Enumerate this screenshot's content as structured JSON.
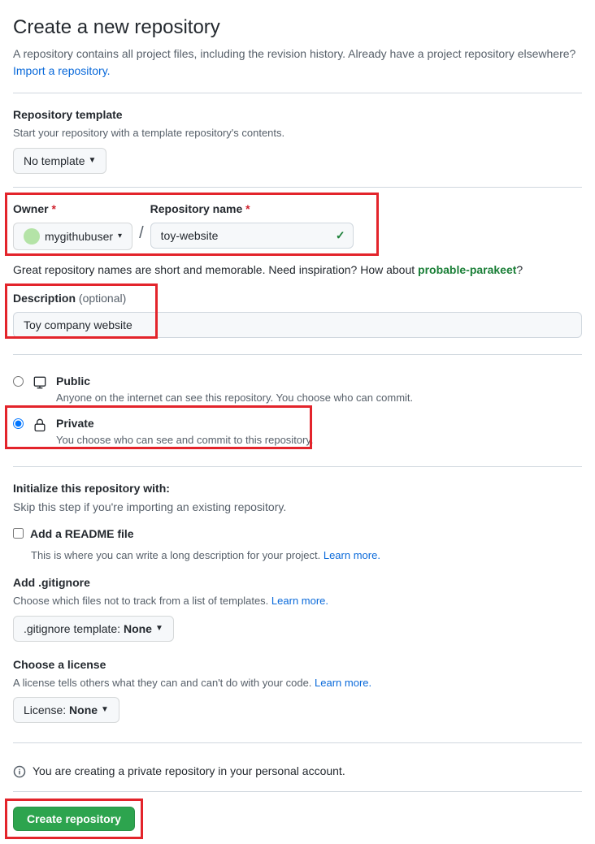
{
  "header": {
    "title": "Create a new repository",
    "subhead": "A repository contains all project files, including the revision history. Already have a project repository elsewhere? ",
    "import_link": "Import a repository."
  },
  "template": {
    "label": "Repository template",
    "help": "Start your repository with a template repository's contents.",
    "button": "No template"
  },
  "owner": {
    "label": "Owner",
    "username": "mygithubuser"
  },
  "repo_name": {
    "label": "Repository name",
    "value": "toy-website"
  },
  "name_hint": {
    "prefix": "Great repository names are short and memorable. Need inspiration? How about ",
    "suggestion": "probable-parakeet",
    "suffix": "?"
  },
  "description": {
    "label": "Description",
    "optional": "(optional)",
    "value": "Toy company website"
  },
  "visibility": {
    "public": {
      "title": "Public",
      "desc": "Anyone on the internet can see this repository. You choose who can commit."
    },
    "private": {
      "title": "Private",
      "desc": "You choose who can see and commit to this repository."
    }
  },
  "init": {
    "title": "Initialize this repository with:",
    "skip": "Skip this step if you're importing an existing repository.",
    "readme_title": "Add a README file",
    "readme_desc": "This is where you can write a long description for your project. ",
    "learn_more": "Learn more."
  },
  "gitignore": {
    "title": "Add .gitignore",
    "desc": "Choose which files not to track from a list of templates. ",
    "button_prefix": ".gitignore template: ",
    "value": "None"
  },
  "license": {
    "title": "Choose a license",
    "desc": "A license tells others what they can and can't do with your code. ",
    "button_prefix": "License: ",
    "value": "None"
  },
  "notice": "You are creating a private repository in your personal account.",
  "submit": "Create repository"
}
